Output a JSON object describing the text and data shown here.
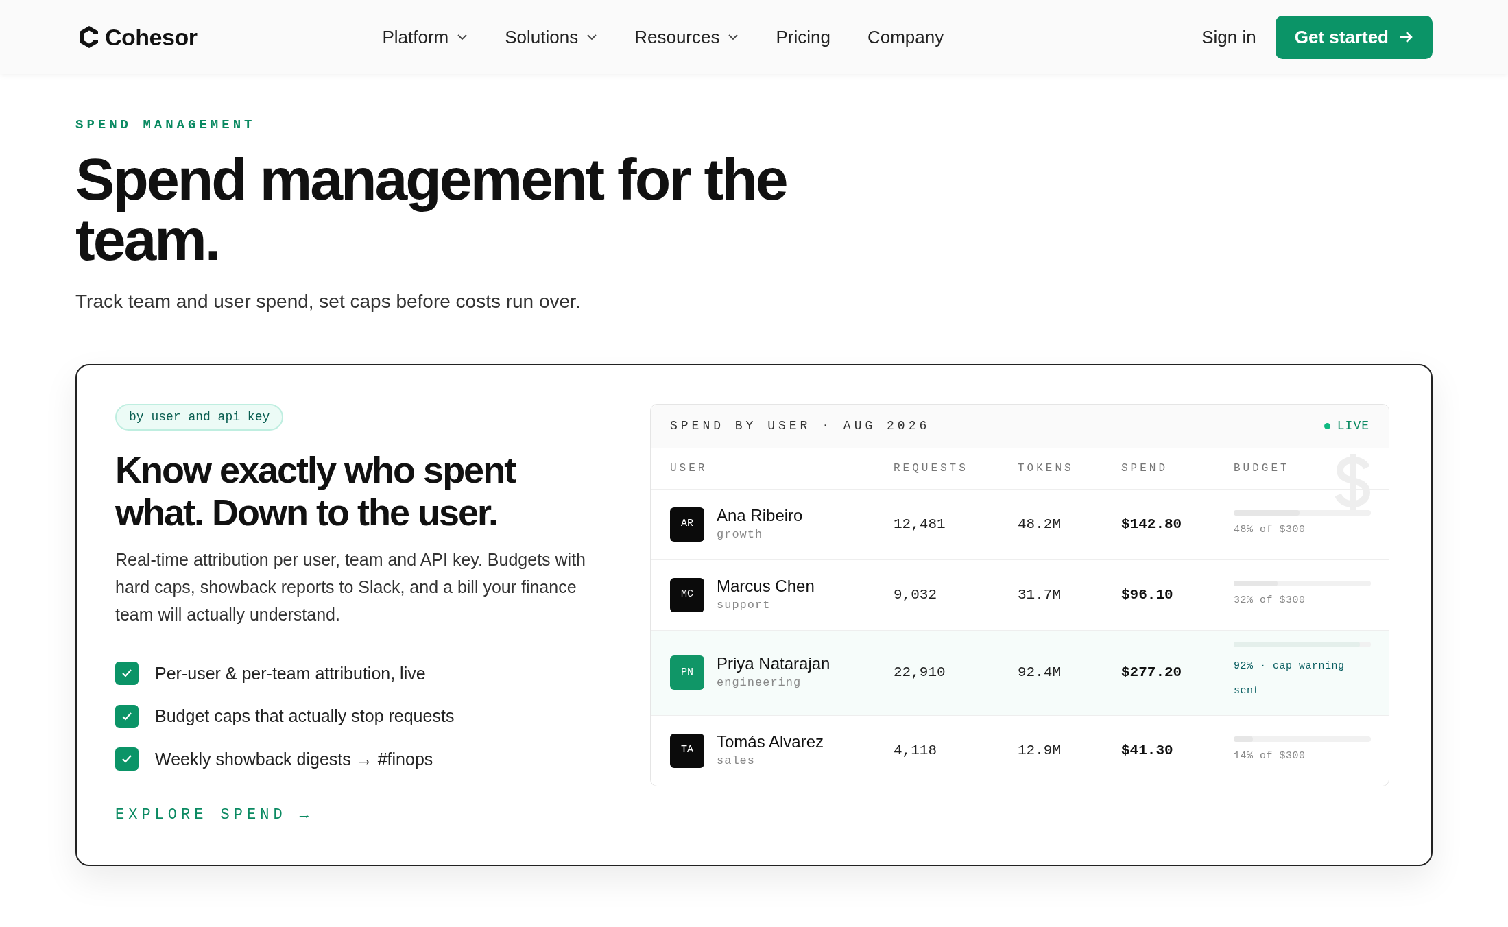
{
  "nav": {
    "brand": "Cohesor",
    "items": [
      {
        "label": "Platform",
        "dropdown": true
      },
      {
        "label": "Solutions",
        "dropdown": true
      },
      {
        "label": "Resources",
        "dropdown": true
      },
      {
        "label": "Pricing",
        "dropdown": false
      },
      {
        "label": "Company",
        "dropdown": false
      }
    ],
    "sign_in": "Sign in",
    "cta": "Get started"
  },
  "hero": {
    "eyebrow": "SPEND MANAGEMENT",
    "title": "Spend management for the team.",
    "subtitle": "Track team and user spend, set caps before costs run over."
  },
  "feature": {
    "pill": "by user and api key",
    "heading": "Know exactly who spent what. Down to the user.",
    "body": "Real-time attribution per user, team and API key. Budgets with hard caps, showback reports to Slack, and a bill your finance team will actually understand.",
    "checklist": [
      {
        "label": "Per-user & per-team attribution, live",
        "checked": true
      },
      {
        "label": "Budget caps that actually stop requests",
        "checked": true
      },
      {
        "label": "Weekly showback digests → #finops",
        "checked": true
      }
    ],
    "link": "EXPLORE SPEND →"
  },
  "table": {
    "title": "SPEND BY USER · AUG 2026",
    "live": "LIVE",
    "columns": [
      "USER",
      "REQUESTS",
      "TOKENS",
      "SPEND",
      "BUDGET"
    ],
    "rows": [
      {
        "initials": "AR",
        "name": "Ana Ribeiro",
        "team": "growth",
        "requests": "12,481",
        "tokens": "48.2M",
        "spend": "$142.80",
        "budget": "48% of $300",
        "level": 0.48,
        "warning": false
      },
      {
        "initials": "MC",
        "name": "Marcus Chen",
        "team": "support",
        "requests": "9,032",
        "tokens": "31.7M",
        "spend": "$96.10",
        "budget": "32% of $300",
        "level": 0.32,
        "warning": false
      },
      {
        "initials": "PN",
        "name": "Priya Natarajan",
        "team": "engineering",
        "requests": "22,910",
        "tokens": "92.4M",
        "spend": "$277.20",
        "budget": "92% · cap warning sent",
        "level": 0.92,
        "warning": true
      },
      {
        "initials": "TA",
        "name": "Tomás Alvarez",
        "team": "sales",
        "requests": "4,118",
        "tokens": "12.9M",
        "spend": "$41.30",
        "budget": "14% of $300",
        "level": 0.14,
        "warning": false
      }
    ]
  }
}
